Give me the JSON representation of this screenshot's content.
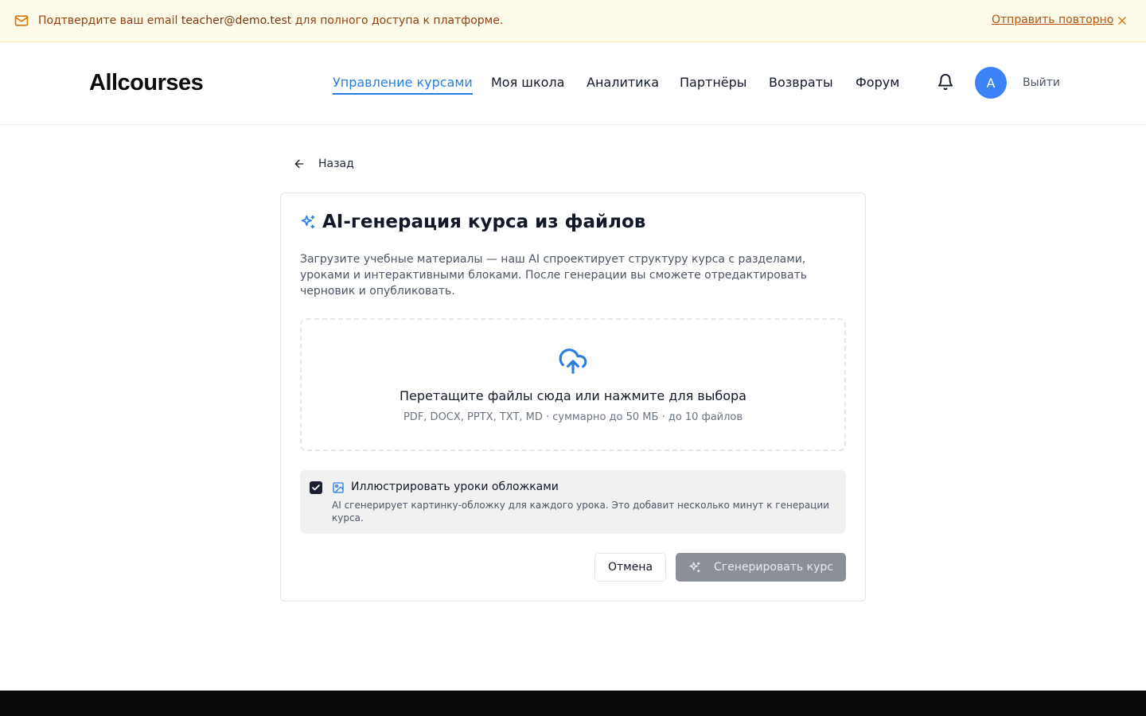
{
  "banner": {
    "text_before": "Подтвердите ваш email ",
    "email": "teacher@demo.test",
    "text_after": " для полного доступа к платформе.",
    "resend_label": "Отправить повторно"
  },
  "header": {
    "logo": "Allcourses",
    "nav": [
      {
        "label": "Управление курсами",
        "active": true
      },
      {
        "label": "Моя школа"
      },
      {
        "label": "Аналитика"
      },
      {
        "label": "Партнёры"
      },
      {
        "label": "Возвраты"
      },
      {
        "label": "Форум"
      }
    ],
    "avatar_initial": "A",
    "logout_label": "Выйти"
  },
  "back_label": "Назад",
  "card": {
    "title": "AI-генерация курса из файлов",
    "description": "Загрузите учебные материалы — наш AI спроектирует структуру курса с разделами, уроками и интерактивными блоками. После генерации вы сможете отредактировать черновик и опубликовать.",
    "dropzone": {
      "title": "Перетащите файлы сюда или нажмите для выбора",
      "subtitle": "PDF, DOCX, PPTX, TXT, MD · суммарно до 50 МБ · до 10 файлов"
    },
    "option": {
      "checked": true,
      "title": "Иллюстрировать уроки обложками",
      "description": "AI сгенерирует картинку-обложку для каждого урока. Это добавит несколько минут к генерации курса."
    },
    "cancel_label": "Отмена",
    "generate_label": "Сгенерировать курс"
  },
  "colors": {
    "accent": "#2b7de0",
    "banner_bg": "#fefbeb",
    "banner_text": "#92400e",
    "avatar_bg": "#3b82f6",
    "generate_disabled_bg": "#8a8f98"
  }
}
